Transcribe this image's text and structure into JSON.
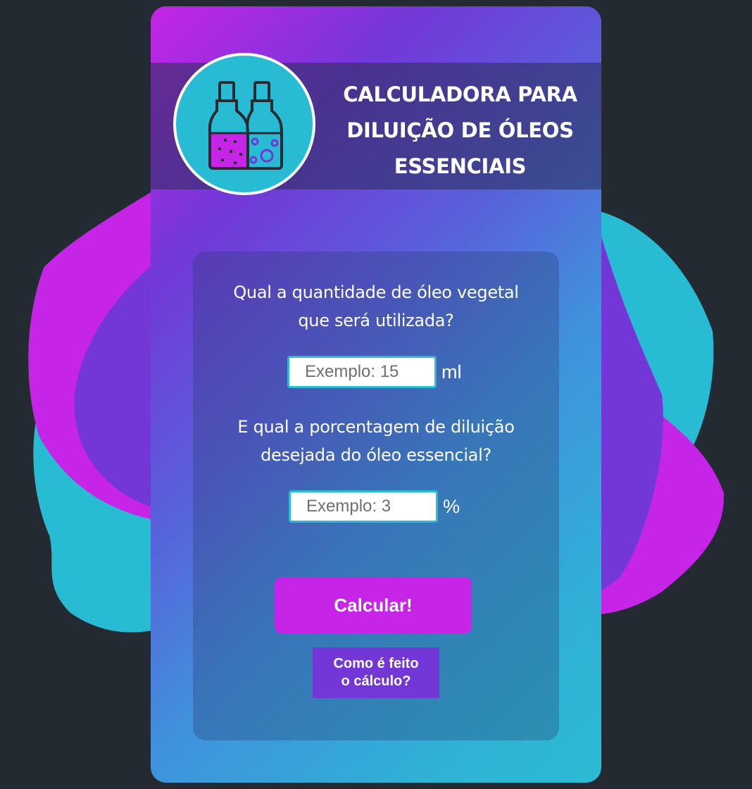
{
  "header": {
    "title_lines": [
      "CALCULADORA PARA",
      "DILUIÇÃO DE ÓLEOS",
      "ESSENCIAIS"
    ],
    "logo_icon": "potion-bottles-icon"
  },
  "form": {
    "oil_question_lines": [
      "Qual a quantidade de óleo vegetal",
      "que será utilizada?"
    ],
    "oil_input": {
      "placeholder": "Exemplo: 15",
      "value": ""
    },
    "oil_unit": "ml",
    "dilution_question_lines": [
      "E qual a porcentagem de diluição",
      "desejada do óleo essencial?"
    ],
    "dilution_input": {
      "placeholder": "Exemplo: 3",
      "value": ""
    },
    "dilution_unit": "%",
    "calculate_label": "Calcular!",
    "how_lines": [
      "Como é feito",
      "o cálculo?"
    ]
  },
  "colors": {
    "background": "#232a31",
    "magenta": "#c624e6",
    "purple": "#7337d8",
    "cyan": "#27bcd3",
    "white": "#ffffff"
  }
}
